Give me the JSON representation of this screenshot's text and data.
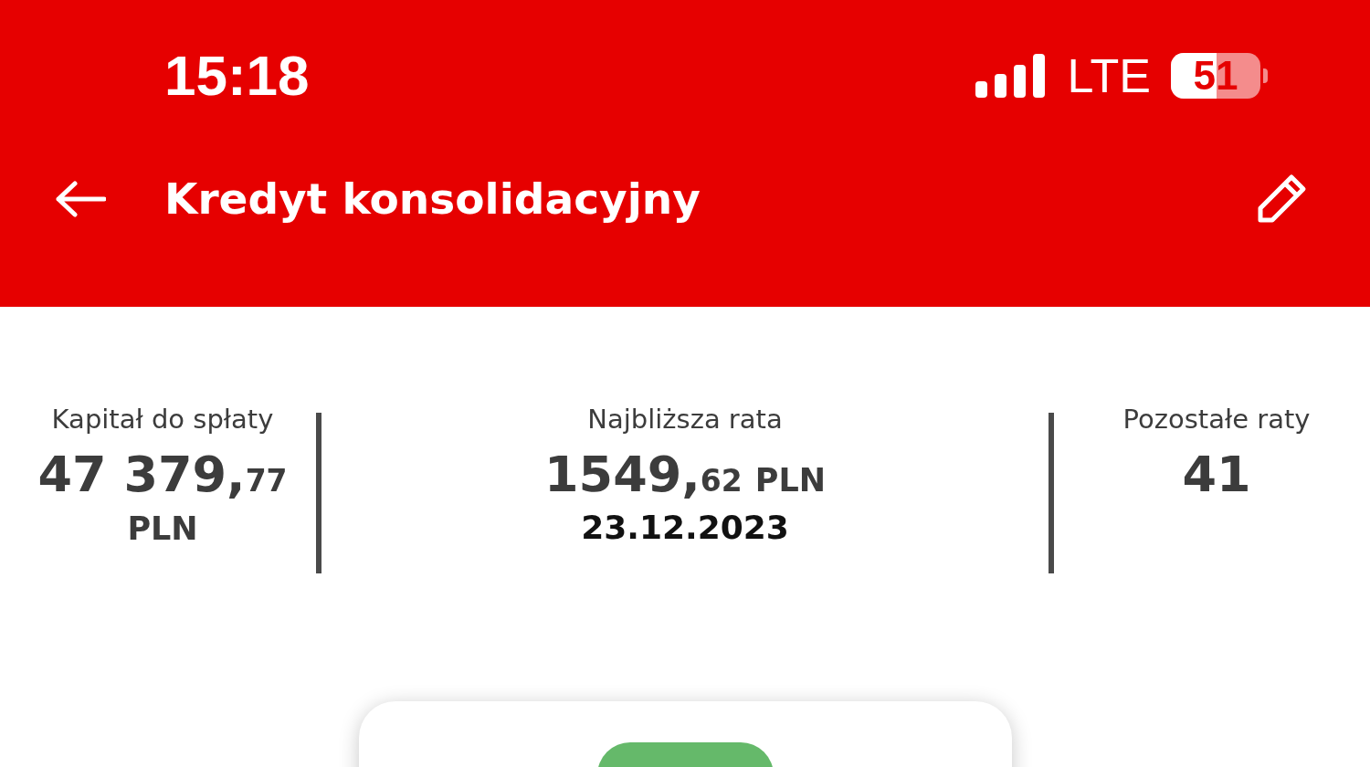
{
  "status_bar": {
    "time": "15:18",
    "network": "LTE",
    "battery": "51"
  },
  "header": {
    "title": "Kredyt konsolidacyjny"
  },
  "stats": [
    {
      "label": "Kapitał do spłaty",
      "amount": "47 379,",
      "fraction": "77",
      "currency": "PLN",
      "currency_below": true
    },
    {
      "label": "Najbliższa rata",
      "amount": "1549,",
      "fraction": "62",
      "currency": "PLN",
      "currency_below": false,
      "date": "23.12.2023"
    },
    {
      "label": "Pozostałe raty",
      "amount": "41"
    }
  ]
}
